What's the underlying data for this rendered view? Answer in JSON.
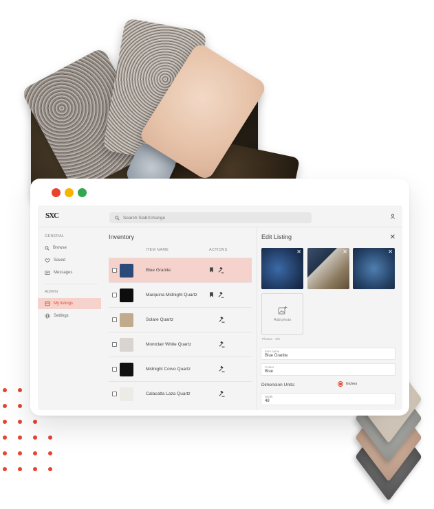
{
  "colors": {
    "accent": "#e8442d",
    "selected_row": "#f6d2cc"
  },
  "window": {
    "traffic_lights": [
      "#e8442d",
      "#f5b400",
      "#2fa84f"
    ]
  },
  "topbar": {
    "logo": "SXC",
    "search_placeholder": "Search SlabXchange"
  },
  "sidebar": {
    "general_heading": "GENERAL",
    "admin_heading": "ADMIN",
    "general_items": [
      {
        "label": "Browse",
        "icon": "search-icon"
      },
      {
        "label": "Saved",
        "icon": "heart-icon"
      },
      {
        "label": "Messages",
        "icon": "message-icon"
      }
    ],
    "admin_items": [
      {
        "label": "My listings",
        "icon": "listings-icon",
        "active": true
      },
      {
        "label": "Settings",
        "icon": "gear-icon"
      }
    ]
  },
  "inventory": {
    "title": "Inventory",
    "col_item_name": "ITEM NAME",
    "col_actions": "ACTIONS",
    "rows": [
      {
        "name": "Blue Granite",
        "selected": true,
        "thumb": "#2b4a7a",
        "bookmark": true
      },
      {
        "name": "Marquina Midnight Quartz",
        "selected": false,
        "thumb": "#0d0d0d",
        "bookmark": true
      },
      {
        "name": "Solare Quartz",
        "selected": false,
        "thumb": "#c2ab8c",
        "bookmark": false
      },
      {
        "name": "Montclair White Quartz",
        "selected": false,
        "thumb": "#d9d4cf",
        "bookmark": false
      },
      {
        "name": "Midnight Corvo Quartz",
        "selected": false,
        "thumb": "#111111",
        "bookmark": false
      },
      {
        "name": "Calacatta Laza Quartz",
        "selected": false,
        "thumb": "#ecebe6",
        "bookmark": false
      }
    ]
  },
  "edit": {
    "title": "Edit Listing",
    "add_photo_label": "Add photo",
    "photo_count": "Photos · 3/6",
    "item_name_label": "Item name",
    "item_name_value": "Blue Granite",
    "colour_label": "Colour",
    "colour_value": "Blue",
    "dimension_units_label": "Dimension Units:",
    "units_option": "Inches",
    "width_label": "Width",
    "width_value": "48"
  }
}
